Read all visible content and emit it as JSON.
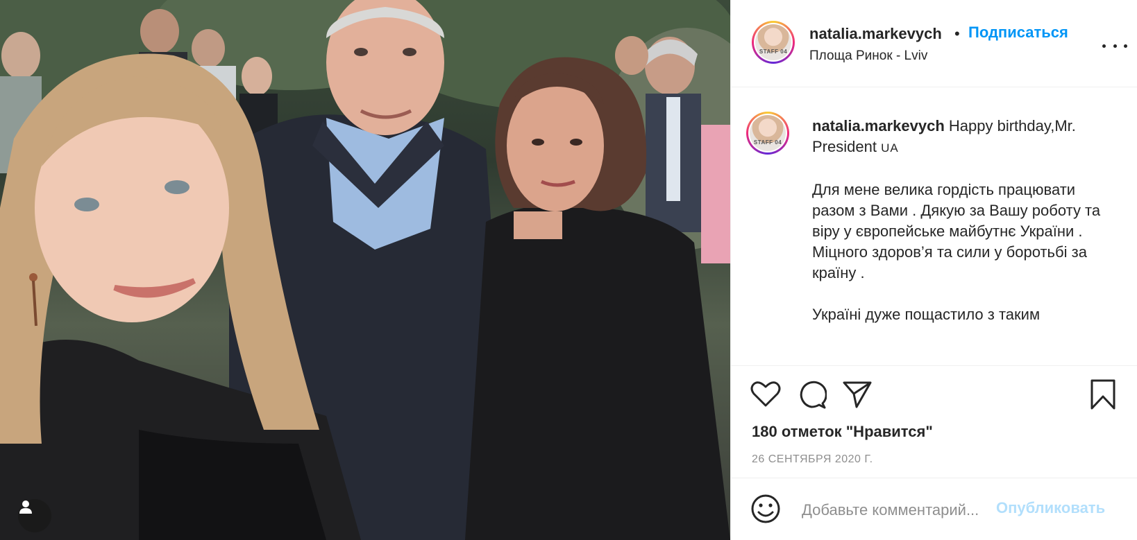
{
  "photo": {
    "description_icon": "person-tag-icon"
  },
  "header": {
    "username": "natalia.markevych",
    "separator": "•",
    "follow_label": "Подписаться",
    "location": "Площа Ринок - Lviv",
    "avatar_text": "STAFF 04",
    "more_icon": "more-horizontal-icon"
  },
  "caption": {
    "username": "natalia.markevych",
    "headline": " Happy birthday,Mr. President",
    "flag": "UA",
    "body": "Для мене велика гордість працювати разом з Вами . Дякую за Вашу роботу та віру у європейське майбутнє України .\nМіцного здоров’я та сили у боротьбі за країну .\n\nУкраїні дуже пощастило з таким"
  },
  "actions": {
    "like_icon": "heart-icon",
    "comment_icon": "comment-icon",
    "share_icon": "send-icon",
    "save_icon": "bookmark-icon",
    "likes_text": "180 отметок \"Нравится\"",
    "date_text": "26 СЕНТЯБРЯ 2020 Г."
  },
  "comment": {
    "emoji_icon": "smiley-icon",
    "placeholder": "Добавьте комментарий...",
    "publish_label": "Опубликовать"
  },
  "colors": {
    "accent": "#0095f6",
    "publish_disabled": "#b2dffc",
    "text": "#262626",
    "muted": "#8e8e8e",
    "border": "#efefef"
  }
}
